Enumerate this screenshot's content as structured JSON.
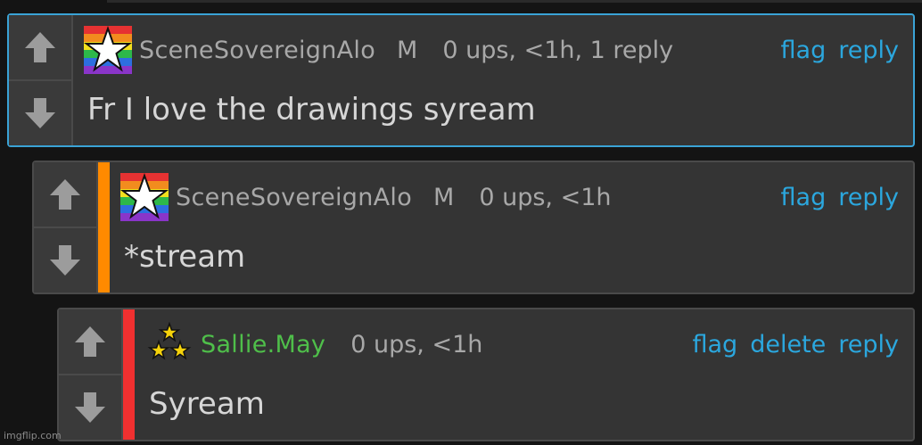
{
  "comments": [
    {
      "username": "SceneSovereignAlo",
      "mod_flag": "M",
      "stats": "0 ups, <1h, 1 reply",
      "text": "Fr I love the drawings syream",
      "actions": [
        "flag",
        "reply"
      ],
      "badge_icon": "rainbow-star-icon",
      "depth_color": "",
      "selected": true
    },
    {
      "username": "SceneSovereignAlo",
      "mod_flag": "M",
      "stats": "0 ups, <1h",
      "text": "*stream",
      "actions": [
        "flag",
        "reply"
      ],
      "badge_icon": "rainbow-star-icon",
      "depth_color": "#ff8a00",
      "selected": false
    },
    {
      "username": "Sallie.May",
      "mod_flag": "",
      "stats": "0 ups, <1h",
      "text": "Syream",
      "actions": [
        "flag",
        "delete",
        "reply"
      ],
      "badge_icon": "three-stars-icon",
      "depth_color": "#f03030",
      "selected": false
    }
  ],
  "colors": {
    "link": "#2ba7de",
    "username": "#a8a8a8",
    "username_self": "#4fbf4a",
    "selected_border": "#3aa3d6"
  },
  "watermark": "imgflip.com"
}
